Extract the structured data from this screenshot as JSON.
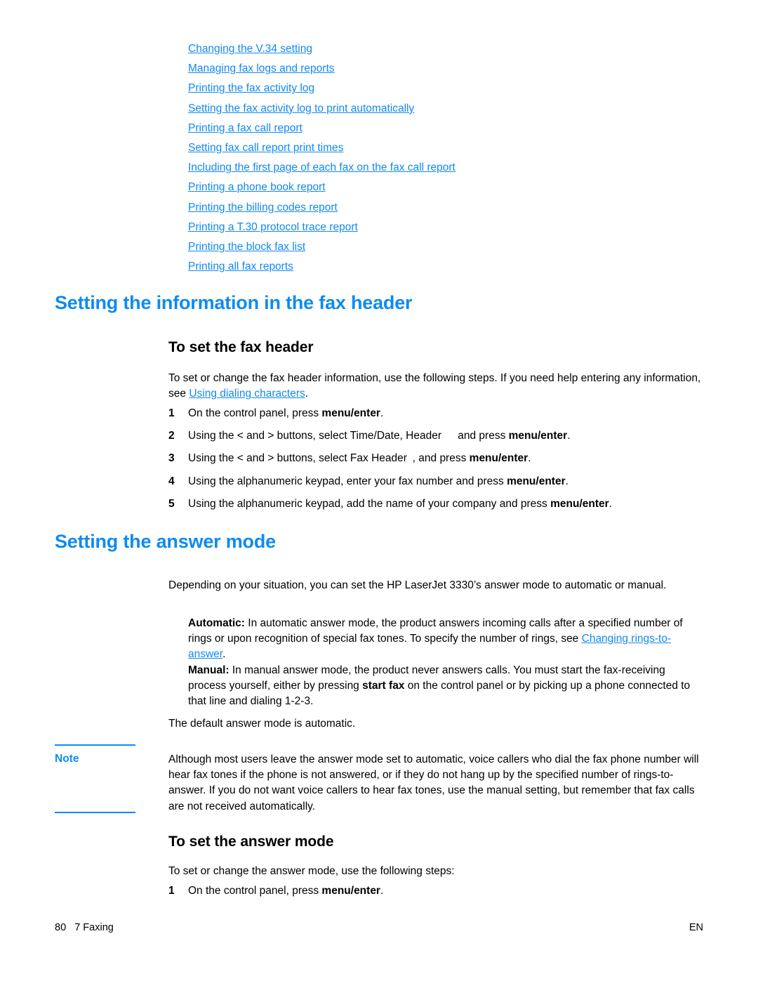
{
  "toc": {
    "links": [
      "Changing the V.34 setting",
      "Managing fax logs and reports",
      "Printing the fax activity log",
      "Setting the fax activity log to print automatically",
      "Printing a fax call report",
      "Setting fax call report print times",
      "Including the first page of each fax on the fax call report",
      "Printing a phone book report",
      "Printing the billing codes report",
      "Printing a T.30 protocol trace report",
      "Printing the block fax list",
      "Printing all fax reports"
    ]
  },
  "sections": {
    "fax_header": {
      "heading": "Setting the information in the fax header",
      "subheading": "To set the fax header",
      "intro_part1": "To set or change the fax header information, use the following steps. If you need help entering any information, see ",
      "intro_link": "Using dialing characters",
      "intro_part2": ".",
      "steps": [
        {
          "num": "1",
          "parts": [
            {
              "text": "On the control panel, press ",
              "bold": false
            },
            {
              "text": "menu/enter",
              "bold": true
            },
            {
              "text": ".",
              "bold": false
            }
          ]
        },
        {
          "num": "2",
          "parts": [
            {
              "text": "Using the < and > buttons, select Time/Date, Header  and press ",
              "bold": false
            },
            {
              "text": "menu/enter",
              "bold": true
            },
            {
              "text": ".",
              "bold": false
            }
          ]
        },
        {
          "num": "3",
          "parts": [
            {
              "text": "Using the < and > buttons, select Fax Header , and press ",
              "bold": false
            },
            {
              "text": "menu/enter",
              "bold": true
            },
            {
              "text": ".",
              "bold": false
            }
          ]
        },
        {
          "num": "4",
          "parts": [
            {
              "text": "Using the alphanumeric keypad, enter your fax number and press ",
              "bold": false
            },
            {
              "text": "menu/enter",
              "bold": true
            },
            {
              "text": ".",
              "bold": false
            }
          ]
        },
        {
          "num": "5",
          "parts": [
            {
              "text": "Using the alphanumeric keypad, add the name of your company and press ",
              "bold": false
            },
            {
              "text": "menu/enter",
              "bold": true
            },
            {
              "text": ".",
              "bold": false
            }
          ]
        }
      ]
    },
    "answer_mode": {
      "heading": "Setting the answer mode",
      "intro": "Depending on your situation, you can set the HP LaserJet 3330’s answer mode to automatic or manual.",
      "automatic_label": "Automatic:",
      "automatic_text_part1": " In automatic answer mode, the product answers incoming calls after a specified number of rings or upon recognition of special fax tones. To specify the number of rings, see ",
      "automatic_link": "Changing rings-to-answer",
      "automatic_text_part2": ".",
      "manual_label": "Manual:",
      "manual_text_part1": " In manual answer mode, the product never answers calls. You must start the fax-receiving process yourself, either by pressing ",
      "manual_bold": "start fax",
      "manual_text_part2": " on the control panel or by picking up a phone connected to that line and dialing 1-2-3.",
      "default_text": "The default answer mode is automatic.",
      "subheading": "To set the answer mode",
      "intro2": "To set or change the answer mode, use the following steps:",
      "steps": [
        {
          "num": "1",
          "parts": [
            {
              "text": "On the control panel, press ",
              "bold": false
            },
            {
              "text": "menu/enter",
              "bold": true
            },
            {
              "text": ".",
              "bold": false
            }
          ]
        }
      ]
    }
  },
  "note": {
    "label": "Note",
    "text": "Although most users leave the answer mode set to automatic, voice callers who dial the fax phone number will hear fax tones if the phone is not answered, or if they do not hang up by the specified number of rings-to-answer. If you do not want voice callers to hear fax tones, use the manual setting, but remember that fax calls are not received automatically."
  },
  "footer": {
    "left": "80   7 Faxing",
    "right": "EN"
  },
  "colors": {
    "link": "#1189f0",
    "heading": "#0d8bf2",
    "text": "#000000",
    "background": "#ffffff"
  }
}
